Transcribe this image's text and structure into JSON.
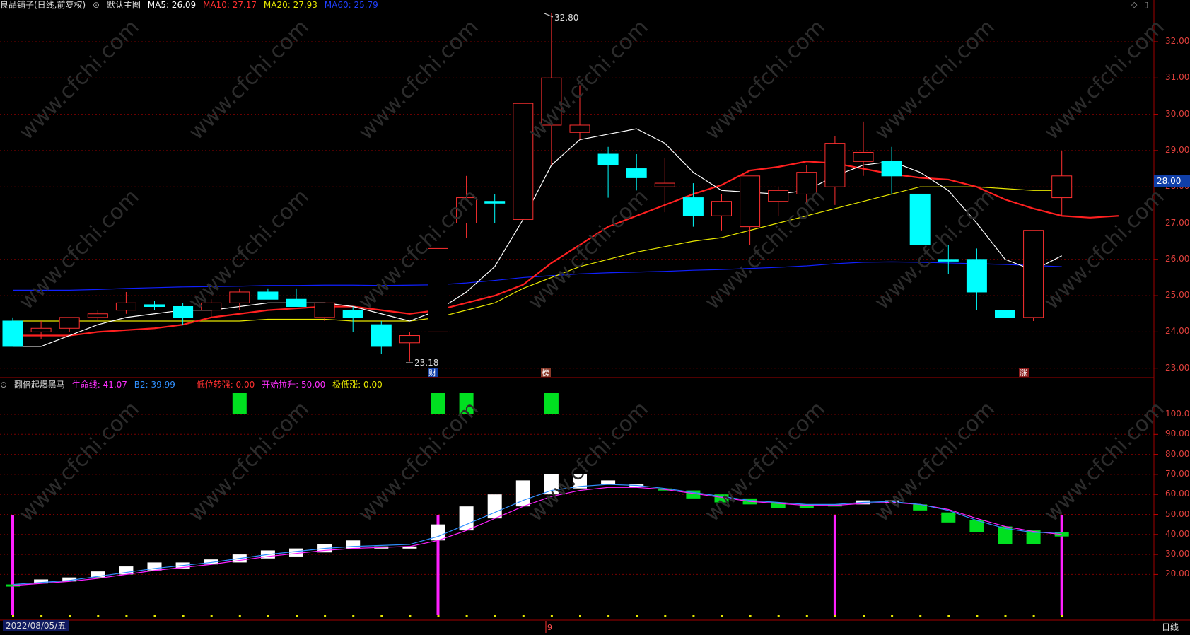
{
  "header_main": {
    "stock": "良品铺子(日线,前复权)",
    "chart_name": "默认主图",
    "ma5_label": "MA5: 26.09",
    "ma10_label": "MA10: 27.17",
    "ma20_label": "MA20: 27.93",
    "ma60_label": "MA60: 25.79"
  },
  "header_sub": {
    "indicator": "翻倍起爆黑马",
    "life_line": "生命线: 41.07",
    "b2": "B2: 39.99",
    "low_turn": "低位转强: 0.00",
    "start_rise": "开始拉升: 50.00",
    "low_rise": "极低涨: 0.00"
  },
  "price_axis": [
    "32.00",
    "31.00",
    "30.00",
    "29.00",
    "28.00",
    "27.00",
    "26.00",
    "25.00",
    "24.00",
    "23.00"
  ],
  "current_price": "28.00",
  "indicator_axis": [
    "100.0",
    "90.00",
    "80.00",
    "70.00",
    "60.00",
    "50.00",
    "40.00",
    "30.00",
    "20.00"
  ],
  "annotations": {
    "high": "32.80",
    "low": "23.18",
    "mark_cai": "财",
    "mark_bang": "榜",
    "mark_zhang": "涨",
    "mark_9": "9"
  },
  "footer": {
    "date": "2022/08/05/五",
    "period": "日线"
  },
  "watermark": "www.cfchi.com",
  "colors": {
    "up": "#ff3030",
    "down": "#00ffff",
    "ma5": "#ffffff",
    "ma10": "#ff2020",
    "ma20": "#e8e800",
    "ma60": "#1020ff",
    "grid": "#7a0000",
    "ind_up": "#ffffff",
    "ind_down": "#00e020",
    "magenta": "#ff20ff"
  },
  "chart_data": [
    {
      "type": "candlestick",
      "title": "良品铺子(日线,前复权)",
      "ylim": [
        22.8,
        33.0
      ],
      "candles": [
        {
          "o": 24.3,
          "h": 24.4,
          "l": 23.6,
          "c": 23.6
        },
        {
          "o": 24.0,
          "h": 24.3,
          "l": 23.8,
          "c": 24.1
        },
        {
          "o": 24.1,
          "h": 24.4,
          "l": 24.0,
          "c": 24.4
        },
        {
          "o": 24.4,
          "h": 24.6,
          "l": 24.3,
          "c": 24.5
        },
        {
          "o": 24.6,
          "h": 25.1,
          "l": 24.5,
          "c": 24.8
        },
        {
          "o": 24.75,
          "h": 24.85,
          "l": 24.6,
          "c": 24.7
        },
        {
          "o": 24.7,
          "h": 24.8,
          "l": 24.2,
          "c": 24.4
        },
        {
          "o": 24.6,
          "h": 24.9,
          "l": 24.4,
          "c": 24.8
        },
        {
          "o": 24.8,
          "h": 25.2,
          "l": 24.6,
          "c": 25.1
        },
        {
          "o": 25.1,
          "h": 25.2,
          "l": 24.9,
          "c": 24.9
        },
        {
          "o": 24.9,
          "h": 25.2,
          "l": 24.7,
          "c": 24.7
        },
        {
          "o": 24.4,
          "h": 24.8,
          "l": 24.3,
          "c": 24.8
        },
        {
          "o": 24.6,
          "h": 24.7,
          "l": 24.0,
          "c": 24.4
        },
        {
          "o": 24.2,
          "h": 24.3,
          "l": 23.4,
          "c": 23.6
        },
        {
          "o": 23.7,
          "h": 24.0,
          "l": 23.18,
          "c": 23.9
        },
        {
          "o": 24.0,
          "h": 26.3,
          "l": 24.0,
          "c": 26.3
        },
        {
          "o": 27.0,
          "h": 28.3,
          "l": 26.6,
          "c": 27.7
        },
        {
          "o": 27.6,
          "h": 27.8,
          "l": 27.0,
          "c": 27.55
        },
        {
          "o": 27.1,
          "h": 30.3,
          "l": 27.1,
          "c": 30.3
        },
        {
          "o": 29.7,
          "h": 32.8,
          "l": 28.6,
          "c": 31.0
        },
        {
          "o": 29.5,
          "h": 30.8,
          "l": 29.3,
          "c": 29.7
        },
        {
          "o": 28.9,
          "h": 29.1,
          "l": 27.7,
          "c": 28.6
        },
        {
          "o": 28.5,
          "h": 28.9,
          "l": 27.9,
          "c": 28.25
        },
        {
          "o": 28.0,
          "h": 28.8,
          "l": 27.3,
          "c": 28.1
        },
        {
          "o": 27.7,
          "h": 28.1,
          "l": 26.9,
          "c": 27.2
        },
        {
          "o": 27.2,
          "h": 27.8,
          "l": 26.8,
          "c": 27.6
        },
        {
          "o": 26.9,
          "h": 28.3,
          "l": 26.4,
          "c": 28.3
        },
        {
          "o": 27.6,
          "h": 28.0,
          "l": 27.2,
          "c": 27.9
        },
        {
          "o": 27.8,
          "h": 28.6,
          "l": 27.5,
          "c": 28.4
        },
        {
          "o": 28.0,
          "h": 29.4,
          "l": 27.5,
          "c": 29.2
        },
        {
          "o": 28.7,
          "h": 29.8,
          "l": 28.3,
          "c": 28.95
        },
        {
          "o": 28.7,
          "h": 29.1,
          "l": 27.8,
          "c": 28.3
        },
        {
          "o": 27.8,
          "h": 27.8,
          "l": 26.4,
          "c": 26.4
        },
        {
          "o": 26.0,
          "h": 26.4,
          "l": 25.6,
          "c": 25.95
        },
        {
          "o": 26.0,
          "h": 26.3,
          "l": 24.6,
          "c": 25.1
        },
        {
          "o": 24.6,
          "h": 25.0,
          "l": 24.2,
          "c": 24.4
        },
        {
          "o": 24.4,
          "h": 26.8,
          "l": 24.3,
          "c": 26.8
        },
        {
          "o": 27.7,
          "h": 29.0,
          "l": 27.2,
          "c": 28.3
        }
      ],
      "ma5": [
        23.6,
        23.6,
        23.9,
        24.2,
        24.4,
        24.5,
        24.6,
        24.6,
        24.7,
        24.8,
        24.8,
        24.8,
        24.7,
        24.5,
        24.3,
        24.6,
        25.1,
        25.8,
        27.1,
        28.6,
        29.3,
        29.45,
        29.6,
        29.2,
        28.4,
        27.9,
        27.85,
        27.8,
        27.9,
        28.3,
        28.6,
        28.7,
        28.4,
        27.9,
        27.0,
        26.0,
        25.7,
        26.1
      ],
      "ma10": [
        23.9,
        23.9,
        23.9,
        24.0,
        24.05,
        24.1,
        24.2,
        24.4,
        24.5,
        24.6,
        24.65,
        24.7,
        24.7,
        24.6,
        24.5,
        24.6,
        24.8,
        25.0,
        25.3,
        25.9,
        26.4,
        26.9,
        27.2,
        27.5,
        27.8,
        28.05,
        28.45,
        28.55,
        28.7,
        28.65,
        28.5,
        28.35,
        28.25,
        28.2,
        28.0,
        27.65,
        27.4,
        27.2,
        27.15,
        27.2
      ],
      "ma20": [
        24.3,
        24.3,
        24.3,
        24.3,
        24.3,
        24.3,
        24.3,
        24.3,
        24.3,
        24.35,
        24.35,
        24.35,
        24.3,
        24.3,
        24.3,
        24.4,
        24.6,
        24.8,
        25.2,
        25.5,
        25.8,
        26.0,
        26.2,
        26.35,
        26.5,
        26.6,
        26.8,
        27.0,
        27.2,
        27.4,
        27.6,
        27.8,
        28.0,
        28.0,
        28.0,
        27.95,
        27.9,
        27.9
      ],
      "ma60": [
        25.15,
        25.15,
        25.15,
        25.17,
        25.2,
        25.22,
        25.24,
        25.25,
        25.26,
        25.28,
        25.28,
        25.29,
        25.29,
        25.28,
        25.29,
        25.3,
        25.35,
        25.42,
        25.5,
        25.55,
        25.6,
        25.63,
        25.65,
        25.67,
        25.7,
        25.72,
        25.75,
        25.78,
        25.82,
        25.88,
        25.92,
        25.93,
        25.92,
        25.9,
        25.88,
        25.86,
        25.83,
        25.8
      ]
    },
    {
      "type": "bar",
      "title": "翻倍起爆黑马",
      "ylim": [
        0,
        112
      ],
      "bars": [
        {
          "o": 14,
          "c": 15,
          "up": false
        },
        {
          "o": 15.5,
          "c": 17.5,
          "up": true
        },
        {
          "o": 16.5,
          "c": 18.5,
          "up": true
        },
        {
          "o": 18.5,
          "c": 21.5,
          "up": true
        },
        {
          "o": 20,
          "c": 24,
          "up": true
        },
        {
          "o": 22,
          "c": 26,
          "up": true
        },
        {
          "o": 23,
          "c": 26,
          "up": true
        },
        {
          "o": 25,
          "c": 27.5,
          "up": true
        },
        {
          "o": 26,
          "c": 30,
          "up": true
        },
        {
          "o": 28,
          "c": 32,
          "up": true
        },
        {
          "o": 29,
          "c": 33,
          "up": true
        },
        {
          "o": 31,
          "c": 35,
          "up": true
        },
        {
          "o": 33,
          "c": 37,
          "up": true
        },
        {
          "o": 33,
          "c": 34,
          "up": true
        },
        {
          "o": 33,
          "c": 34,
          "up": true
        },
        {
          "o": 37,
          "c": 45,
          "up": true
        },
        {
          "o": 42,
          "c": 54,
          "up": true
        },
        {
          "o": 48,
          "c": 60,
          "up": true
        },
        {
          "o": 54,
          "c": 67,
          "up": true
        },
        {
          "o": 60,
          "c": 70,
          "up": true
        },
        {
          "o": 63,
          "c": 70,
          "up": true
        },
        {
          "o": 65,
          "c": 67,
          "up": true
        },
        {
          "o": 64,
          "c": 65,
          "up": true
        },
        {
          "o": 63,
          "c": 62,
          "up": false
        },
        {
          "o": 62,
          "c": 58,
          "up": false
        },
        {
          "o": 60,
          "c": 56,
          "up": false
        },
        {
          "o": 58,
          "c": 55,
          "up": false
        },
        {
          "o": 56,
          "c": 53,
          "up": false
        },
        {
          "o": 55,
          "c": 53,
          "up": false
        },
        {
          "o": 55,
          "c": 54,
          "up": false
        },
        {
          "o": 55,
          "c": 57,
          "up": true
        },
        {
          "o": 56,
          "c": 57,
          "up": true
        },
        {
          "o": 55,
          "c": 52,
          "up": false
        },
        {
          "o": 51,
          "c": 46,
          "up": false
        },
        {
          "o": 47,
          "c": 41,
          "up": false
        },
        {
          "o": 44,
          "c": 35,
          "up": false
        },
        {
          "o": 42,
          "c": 35,
          "up": false
        },
        {
          "o": 41,
          "c": 39,
          "up": false
        }
      ],
      "life_line": [
        15,
        16,
        17,
        19,
        21,
        23,
        24.5,
        26,
        28,
        30,
        31.5,
        33,
        34,
        34.5,
        35,
        39,
        45,
        51,
        57,
        62,
        64,
        65,
        64.5,
        63,
        61,
        59,
        57,
        56,
        55,
        55,
        56,
        56.5,
        55,
        52,
        47,
        43,
        41,
        41
      ],
      "b2": [
        14.5,
        15.5,
        16.5,
        18,
        20,
        22,
        23.5,
        25,
        27,
        29,
        30.5,
        32,
        33,
        33.5,
        34,
        37,
        42,
        48,
        54,
        59,
        62,
        63.5,
        63.5,
        62.5,
        60.5,
        58.5,
        56.5,
        55.5,
        54.5,
        54.5,
        55.5,
        56,
        55,
        52.5,
        48,
        44,
        41.5,
        40
      ],
      "start_rise_bars": [
        8,
        15,
        16,
        19
      ],
      "magenta_columns": [
        0,
        15,
        29,
        37
      ]
    }
  ]
}
